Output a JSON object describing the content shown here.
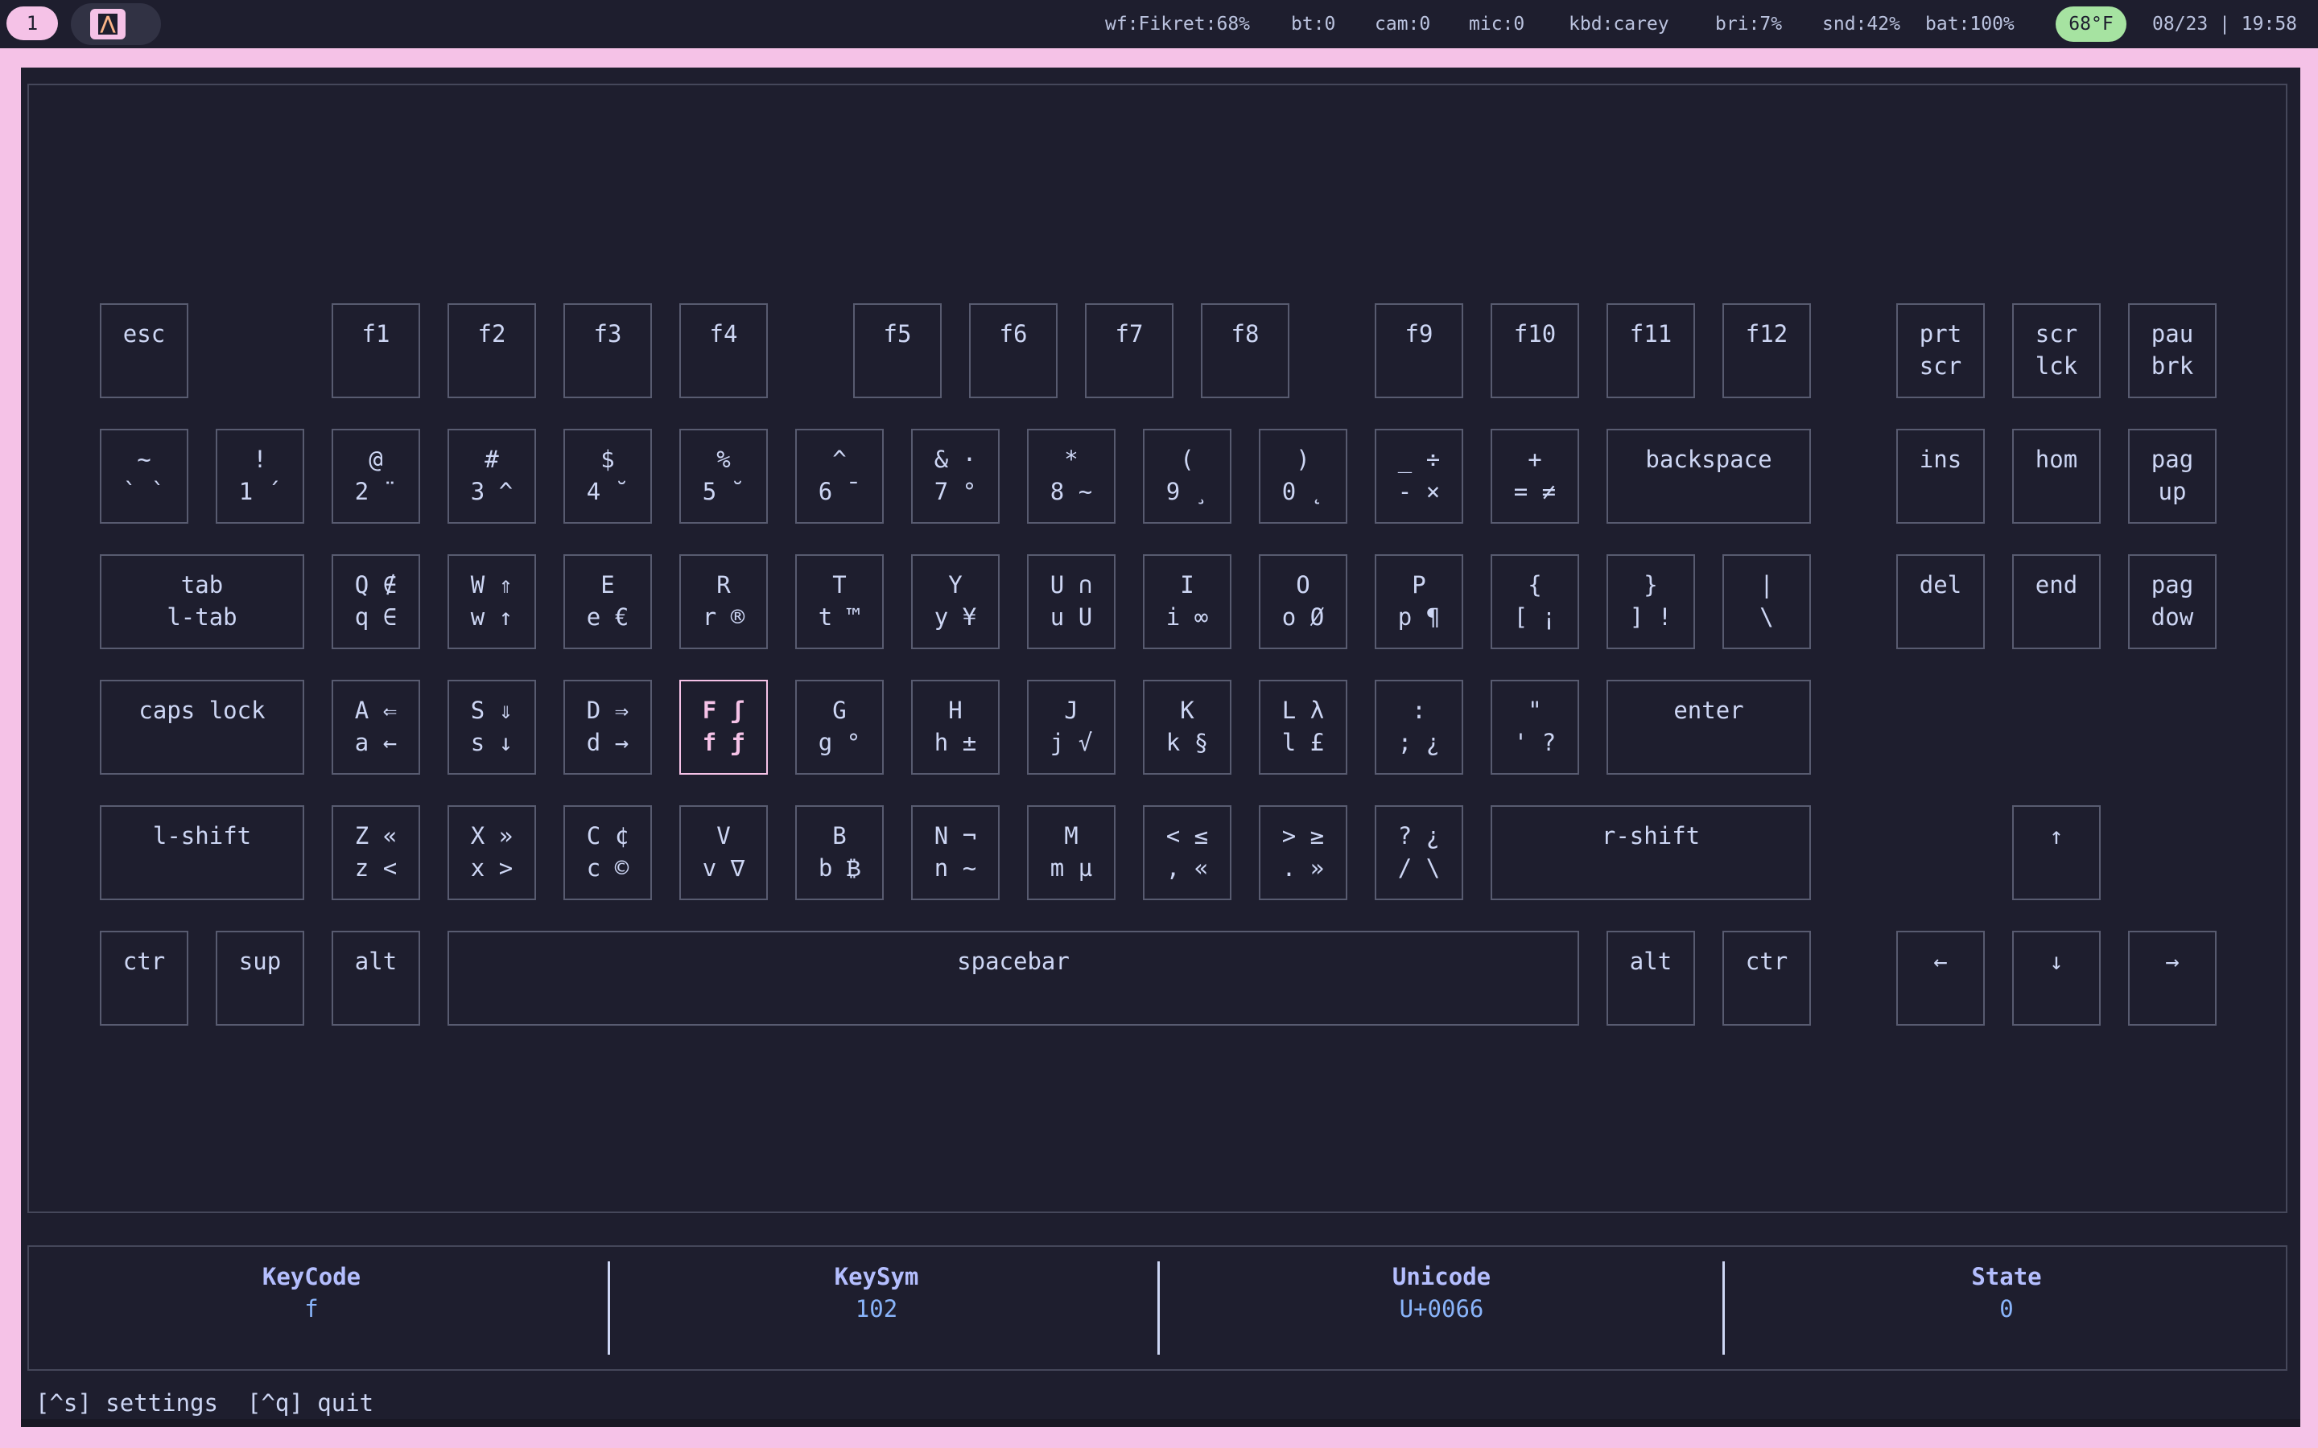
{
  "topbar": {
    "workspace": "1",
    "app_icon": "terminal-app-icon",
    "status": {
      "wifi": "wf:Fikret:68%",
      "bluetooth": "bt:0",
      "camera": "cam:0",
      "mic": "mic:0",
      "keyboard": "kbd:carey",
      "brightness": "bri:7%",
      "sound": "snd:42%",
      "battery": "bat:100%",
      "temperature": "68°F",
      "datetime": "08/23 | 19:58"
    }
  },
  "keyboard": {
    "rows": [
      [
        {
          "id": "esc",
          "label": "esc"
        },
        {
          "id": "f1",
          "label": "f1"
        },
        {
          "id": "f2",
          "label": "f2"
        },
        {
          "id": "f3",
          "label": "f3"
        },
        {
          "id": "f4",
          "label": "f4"
        },
        {
          "id": "f5",
          "label": "f5"
        },
        {
          "id": "f6",
          "label": "f6"
        },
        {
          "id": "f7",
          "label": "f7"
        },
        {
          "id": "f8",
          "label": "f8"
        },
        {
          "id": "f9",
          "label": "f9"
        },
        {
          "id": "f10",
          "label": "f10"
        },
        {
          "id": "f11",
          "label": "f11"
        },
        {
          "id": "f12",
          "label": "f12"
        },
        {
          "id": "prtscr",
          "label": "prt\nscr"
        },
        {
          "id": "scrlck",
          "label": "scr\nlck"
        },
        {
          "id": "paubrk",
          "label": "pau\nbrk"
        }
      ],
      [
        {
          "id": "grave",
          "label": "~\n` `"
        },
        {
          "id": "1",
          "label": "!\n1 ´"
        },
        {
          "id": "2",
          "label": "@\n2 ¨"
        },
        {
          "id": "3",
          "label": "#\n3 ^"
        },
        {
          "id": "4",
          "label": "$\n4 ˘"
        },
        {
          "id": "5",
          "label": "%\n5 ˘"
        },
        {
          "id": "6",
          "label": "^\n6 ¯"
        },
        {
          "id": "7",
          "label": "& ·\n7 °"
        },
        {
          "id": "8",
          "label": "*\n8 ~"
        },
        {
          "id": "9",
          "label": "(\n9 ¸"
        },
        {
          "id": "0",
          "label": ")\n0 ˛"
        },
        {
          "id": "minus",
          "label": "_ ÷\n- ×"
        },
        {
          "id": "equal",
          "label": "+\n= ≠"
        },
        {
          "id": "backspace",
          "label": "backspace"
        },
        {
          "id": "ins",
          "label": "ins"
        },
        {
          "id": "hom",
          "label": "hom"
        },
        {
          "id": "pagup",
          "label": "pag\nup"
        }
      ],
      [
        {
          "id": "tab",
          "label": "tab\nl-tab"
        },
        {
          "id": "q",
          "label": "Q ∉\nq ∈"
        },
        {
          "id": "w",
          "label": "W ⇑\nw ↑"
        },
        {
          "id": "e",
          "label": "E\ne €"
        },
        {
          "id": "r",
          "label": "R\nr ®"
        },
        {
          "id": "t",
          "label": "T\nt ™"
        },
        {
          "id": "y",
          "label": "Y\ny ¥"
        },
        {
          "id": "u",
          "label": "U ∩\nu U"
        },
        {
          "id": "i",
          "label": "I\ni ∞"
        },
        {
          "id": "o",
          "label": "O\no Ø"
        },
        {
          "id": "p",
          "label": "P\np ¶"
        },
        {
          "id": "lbracket",
          "label": "{\n[ ¡"
        },
        {
          "id": "rbracket",
          "label": "}\n] !"
        },
        {
          "id": "backslash",
          "label": "|\n\\"
        },
        {
          "id": "del",
          "label": "del"
        },
        {
          "id": "end",
          "label": "end"
        },
        {
          "id": "pagdow",
          "label": "pag\ndow"
        }
      ],
      [
        {
          "id": "capslock",
          "label": "caps lock"
        },
        {
          "id": "a",
          "label": "A ⇐\na ←"
        },
        {
          "id": "s",
          "label": "S ⇓\ns ↓"
        },
        {
          "id": "d",
          "label": "D ⇒\nd →"
        },
        {
          "id": "f",
          "label": "F ʃ\nf ƒ"
        },
        {
          "id": "g",
          "label": "G\ng °"
        },
        {
          "id": "h",
          "label": "H\nh ±"
        },
        {
          "id": "j",
          "label": "J\nj √"
        },
        {
          "id": "k",
          "label": "K\nk §"
        },
        {
          "id": "l",
          "label": "L λ\nl £"
        },
        {
          "id": "semicolon",
          "label": ":\n; ¿"
        },
        {
          "id": "quote",
          "label": "\"\n' ?"
        },
        {
          "id": "enter",
          "label": "enter"
        }
      ],
      [
        {
          "id": "lshift",
          "label": "l-shift"
        },
        {
          "id": "z",
          "label": "Z «\nz <"
        },
        {
          "id": "x",
          "label": "X »\nx >"
        },
        {
          "id": "c",
          "label": "C ¢\nc ©"
        },
        {
          "id": "v",
          "label": "V\nv ∇"
        },
        {
          "id": "b",
          "label": "B\nb ₿"
        },
        {
          "id": "n",
          "label": "N ¬\nn ~"
        },
        {
          "id": "m",
          "label": "M\nm µ"
        },
        {
          "id": "comma",
          "label": "< ≤\n, «"
        },
        {
          "id": "period",
          "label": "> ≥\n. »"
        },
        {
          "id": "slash",
          "label": "? ¿\n/ \\"
        },
        {
          "id": "rshift",
          "label": "r-shift"
        },
        {
          "id": "up",
          "label": "↑"
        }
      ],
      [
        {
          "id": "lctr",
          "label": "ctr"
        },
        {
          "id": "sup",
          "label": "sup"
        },
        {
          "id": "lalt",
          "label": "alt"
        },
        {
          "id": "space",
          "label": "spacebar"
        },
        {
          "id": "ralt",
          "label": "alt"
        },
        {
          "id": "rctr",
          "label": "ctr"
        },
        {
          "id": "left",
          "label": "←"
        },
        {
          "id": "down",
          "label": "↓"
        },
        {
          "id": "right",
          "label": "→"
        }
      ]
    ],
    "active_key": "f"
  },
  "info": [
    {
      "label": "KeyCode",
      "value": "f"
    },
    {
      "label": "KeySym",
      "value": "102"
    },
    {
      "label": "Unicode",
      "value": "U+0066"
    },
    {
      "label": "State",
      "value": "0"
    }
  ],
  "footer": {
    "settings": "[^s] settings",
    "quit": "[^q] quit"
  },
  "colors": {
    "accent": "#f5c2e7",
    "background": "#1e1e2e",
    "temperature_pill": "#a6e3a1",
    "info_label": "#b4befe",
    "info_value": "#89b4fa"
  }
}
